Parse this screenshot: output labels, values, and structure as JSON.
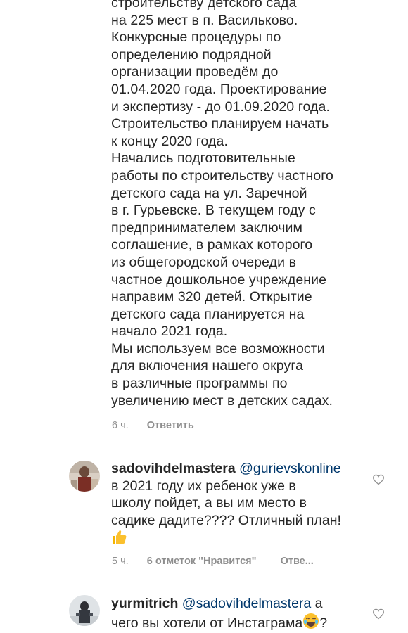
{
  "reply": {
    "lines": [
      "строительству детского сада",
      "на 225 мест в п. Васильково.",
      "Конкурсные процедуры по",
      "определению подрядной",
      "организации проведём до",
      "01.04.2020 года. Проектирование",
      "и экспертизу - до 01.09.2020 года.",
      "Строительство планируем начать",
      "к концу 2020 года.",
      "Начались подготовительные",
      "работы по строительству частного",
      "детского сада на ул. Заречной",
      "в г. Гурьевске. В текущем году с",
      "предпринимателем заключим",
      "соглашение, в рамках которого",
      "из общегородской очереди в",
      "частное дошкольное учреждение",
      "направим 320 детей. Открытие",
      "детского сада планируется на",
      "начало 2021 года.",
      "Мы используем все возможности",
      "для включения нашего округа",
      "в различные программы по",
      "увеличению мест в детских садах."
    ],
    "time": "6 ч.",
    "reply_label": "Ответить"
  },
  "comments": [
    {
      "username": "sadovihdelmastera",
      "mention": "@gurievskonline",
      "lines": [
        "в 2021 году их ребенок уже в",
        "школу пойдет, а вы им место в",
        "садике дадите???? Отличный план!"
      ],
      "emoji": "thumbs-up-emoji",
      "time": "5 ч.",
      "likes": "6 отметок \"Нравится\"",
      "reply_label": "Отве..."
    },
    {
      "username": "yurmitrich",
      "mention": "@sadovihdelmastera",
      "first_line_tail": " а",
      "second_line": "чего вы хотели от Инстаграма",
      "emoji": "laughing-emoji",
      "tail": "?"
    }
  ]
}
